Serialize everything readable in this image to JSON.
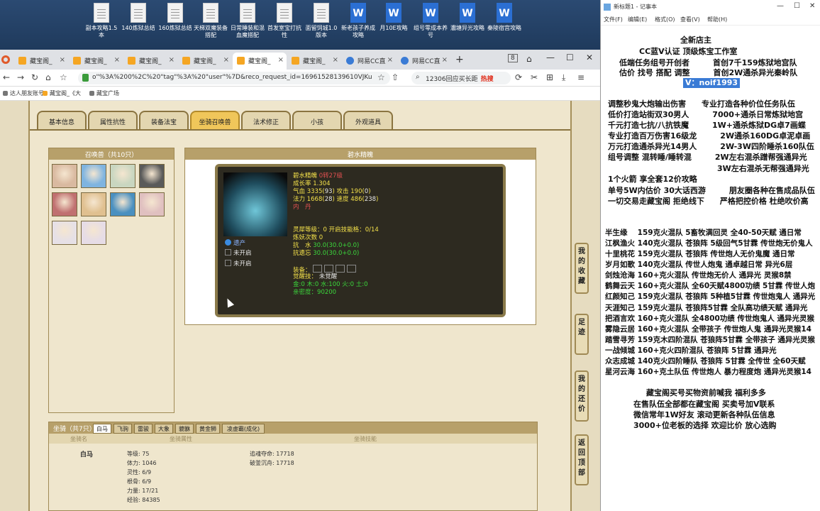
{
  "desktop": {
    "icons": [
      "副本攻略1.5本",
      "140炼狱总结",
      "160炼狱总结",
      "天梯双魔装备搭配",
      "日常睡装和混血魔搭配",
      "首发室宝打抗性",
      "面留饲城1.0版本",
      "新老孩子养成攻略",
      "月10E攻略",
      "组号零成本养号",
      "灞塘异光攻略",
      "秦陵宿宫攻略"
    ]
  },
  "browser": {
    "tabs": [
      {
        "label": "藏宝阁_"
      },
      {
        "label": "藏宝阁_"
      },
      {
        "label": "藏宝阁_"
      },
      {
        "label": "藏宝阁_"
      },
      {
        "label": "藏宝阁_"
      },
      {
        "label": "藏宝阁_"
      },
      {
        "label": "网易CC直"
      },
      {
        "label": "网易CC直"
      }
    ],
    "new_tab": "+",
    "tab_count": "8",
    "url": "o\"%3A%200%2C%20\"tag\"%3A%20\"user\"%7D&reco_request_id=16961528139610VJKu",
    "search_text": "12306回应买长距",
    "search_hot": "热搜",
    "bookmarks": [
      "达人朋友账号",
      "藏宝阁_《大",
      "藏宝广场"
    ]
  },
  "game": {
    "tabs": [
      "基本信息",
      "属性抗性",
      "装备法宝",
      "坐骑召唤兽",
      "法术修正",
      "小孩",
      "外观道具"
    ],
    "active_tab": "坐骑召唤兽",
    "pets_header": "召唤兽（共10只）",
    "detail_header": "碧水精魄",
    "pet": {
      "name": "碧水精魄",
      "level": "0转27级",
      "growth_label": "成长率",
      "growth": "1.304",
      "hp_label": "气血",
      "hp": "3335",
      "hp_add": "93",
      "atk_label": "攻击",
      "atk": "190",
      "atk_add": "0",
      "mp_label": "法力",
      "mp": "1668",
      "mp_add": "28",
      "spd_label": "速度",
      "spd": "486",
      "spd_add": "238",
      "inner": "内　丹",
      "skills": [
        "遗产",
        "未开启",
        "未开启"
      ],
      "soul_label": "灵犀等级",
      "soul": "0",
      "open_skill_label": "开启技能格",
      "open_skill": "0/14",
      "refine_label": "炼妖次数",
      "refine": "0",
      "resist_water_label": "抗　水",
      "resist_water": "30.0(30.0+0.0)",
      "resist_forget_label": "抗遗忘",
      "resist_forget": "30.0(30.0+0.0)",
      "equip_label": "装备",
      "awaken_label": "觉醒技",
      "awaken": "未觉醒",
      "five_elements": "金:0 木:0 水:100 火:0 土:0",
      "intimacy_label": "亲密度",
      "intimacy": "90200"
    },
    "mounts": {
      "header": "坐骑（共7只）",
      "tabs": [
        "白马",
        "飞驹",
        "雷骏",
        "大象",
        "貔貅",
        "黄金狮",
        "凌虚霸(成化)"
      ],
      "cols": [
        "坐骑名",
        "坐骑属性",
        "坐骑技能"
      ],
      "name": "白马",
      "stats": [
        "等级: 75",
        "体力: 1046",
        "灵性: 6/9",
        "根骨: 6/9",
        "力量: 17/21",
        "经验: 84385"
      ],
      "extra": [
        "追魂夺命: 17718",
        "破釜沉舟: 17718"
      ]
    },
    "side_buttons": [
      "我的收藏",
      "足迹",
      "我的还价",
      "返回顶部"
    ]
  },
  "notepad": {
    "title": "新标题1 - 记事本",
    "menu": [
      "文件(F)",
      "编辑(E)",
      "格式(O)",
      "查看(V)",
      "帮助(H)"
    ],
    "lines": [
      "全新店主",
      "CC蓝V认证 顶级炼宝工作室",
      "低端任务组号开创者　　　首创7千159炼狱地宫队",
      "估价 找号 搭配 调整　　　首创2W通杀异光秦岭队",
      "V：noif1993",
      "调整秒鬼大炮输出伤害　　专业打造各种价位任务队伍",
      "低价打造站街双30男人　　　7000+通杀日常炼狱地宫",
      "千元打造七抗/八抗铁魔　　　1W+通杀炼狱DG卓7画蝶",
      "专业打造百万伤害16级龙　　　2W通杀160DG卓泥卓画",
      "万元打造通杀异光14男人　　　2W-3W四阶睡杀160队伍",
      "组号调整 混转睡/睡转混　　　2W左右混杀蹭帮强通异光",
      "　　　　　　　　　　　　　　3W左右混杀无帮强通异光",
      "1个火箭 享全套12价攻略",
      "单号5W内估价 30大话西游　　　朋友圈各种在售成品队伍",
      "一切交易走藏宝阁 拒绝线下　　严格把控价格 杜绝吹价高",
      "半生缘　 159克火混队 5畜牧满回灵 全40-50天赋 通日常",
      "江枫渔火 140克火混队 苍狼阵 5级回气5甘霖 传世炮无价鬼人",
      "十里桃花 159克火混队 苍狼阵 传世炮人无价鬼魔 通日常",
      "岁月如歌 140克火混队 传世人炮鬼 通卓越日常 异光6层",
      "剑烛沧海 160+克火混队 传世炮无价人 通异光 灵猴8禁",
      "鹤舞云天 160+克火混队 全60天赋4800功绩 5甘霖 传世人炮",
      "红颜知己 159克火混队 苍狼阵 5种植5甘霖 传世炮鬼人 通异光",
      "天涯知己 159克火混队 苍狼阵5甘霖 全队高功绩天赋 通异光",
      "把酒言欢 160+克火混队 全4800功绩 传世炮鬼人 通异光灵猴",
      "雾隐云居 160+克火混队 全带孩子 传世炮人鬼 通异光灵猴14",
      "踏雪寻芳 159克木四阶混队 苍狼阵5甘霖 全带孩子 通异光灵猴",
      "一战倾城 160+克火四阶混队 苍狼阵 5甘霖 通异光",
      "众志成城 140克火四阶睡队 苍狼阵 5甘霖 全传世 全60天赋",
      "星河云海 160+克土队伍 传世炮人 暴力程度炮 通异光灵猴14",
      "藏宝阁买号买物资前喊我 福利多多",
      "在售队伍全部都在藏宝阁 买卖号加V联系",
      "微信常年1W好友 滚动更新各种队伍信息",
      "3000+位老板的选择 欢迎比价 放心选购"
    ]
  }
}
